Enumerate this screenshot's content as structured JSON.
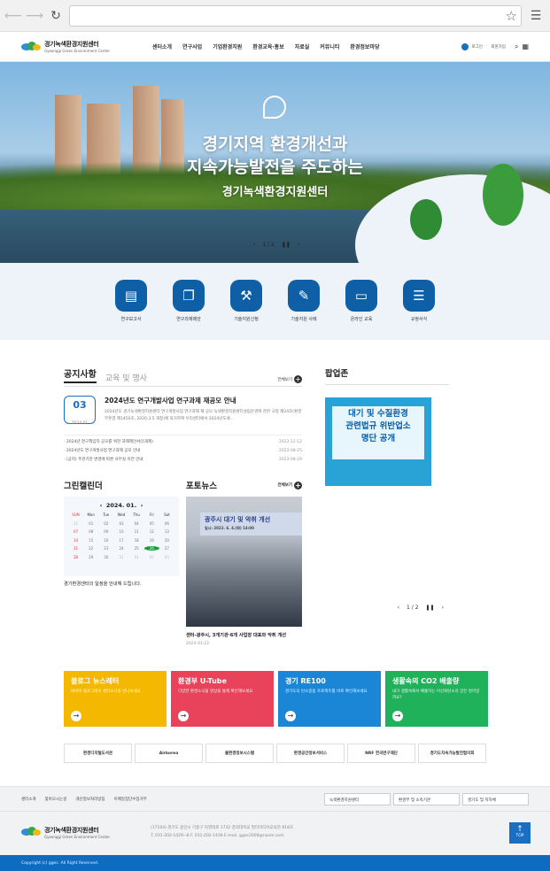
{
  "header": {
    "logo_title": "경기녹색환경지원센터",
    "logo_sub": "Gyeonggi Green Environment Center",
    "nav": [
      "센터소개",
      "연구사업",
      "기업환경지원",
      "환경교육·홍보",
      "자료실",
      "커뮤니티",
      "환경정보마당"
    ],
    "login": "로그인",
    "join": "회원가입"
  },
  "hero": {
    "line1": "경기지역 환경개선과",
    "line2": "지속가능발전을 주도하는",
    "line3": "경기녹색환경지원센터",
    "page": "1 / 2"
  },
  "quick": [
    {
      "label": "연구보고서",
      "icon": "▤"
    },
    {
      "label": "연구과제제안",
      "icon": "❐"
    },
    {
      "label": "기술지원신청",
      "icon": "⚒"
    },
    {
      "label": "기술지원 사례",
      "icon": "✎"
    },
    {
      "label": "온라인 교육",
      "icon": "▭"
    },
    {
      "label": "규정서식",
      "icon": "☰"
    }
  ],
  "notice": {
    "tab_active": "공지사항",
    "tab_inactive": "교육 및 행사",
    "more": "전체보기",
    "top_day": "03",
    "top_month": "2024.01",
    "top_title": "2024년도 연구개발사업 연구과제 재공모 안내",
    "top_desc": "2024년도 경기녹색환경지원센터 연구개발사업 연구과제 재 공모 녹색환경지원센터설립운영에 관한 규정 제24조(환경부훈령 제1450호, 2020.3.5 개정)에 의거하여 우리센터에서 2024년도에...",
    "items": [
      {
        "title": "· 2024년 연구책임자 공모를 위한 과제제안서(5개제)",
        "date": "2023-12-12"
      },
      {
        "title": "· 2024년도 연구개발사업 연구과제 공모 안내",
        "date": "2023-08-25"
      },
      {
        "title": "· (공지) 주관기관 변경에 따른 사무실 이전 안내",
        "date": "2023-08-29"
      }
    ]
  },
  "calendar": {
    "title": "그린캘린더",
    "month": "2024. 01.",
    "weekdays": [
      "SUN",
      "Mon",
      "Tue",
      "Wed",
      "Thu",
      "Fri",
      "Sat"
    ],
    "days": [
      "31",
      "01",
      "02",
      "03",
      "04",
      "05",
      "06",
      "07",
      "08",
      "09",
      "10",
      "11",
      "12",
      "13",
      "14",
      "15",
      "16",
      "17",
      "18",
      "19",
      "20",
      "21",
      "22",
      "23",
      "24",
      "25",
      "26",
      "27",
      "28",
      "29",
      "30",
      "31",
      "01",
      "02",
      "03"
    ],
    "note": "경기환경센터의 일정을 안내해 드립니다."
  },
  "photo": {
    "title": "포토뉴스",
    "more": "전체보기",
    "banner": "광주시 대기 및 악취 개선",
    "banner_sub": "일시: 2022. 6. 4.(화) 14:00",
    "caption": "센터-광주시, 3개기관·6개 사업장 대표와 악취 개선",
    "date": "2024-01-22"
  },
  "popup": {
    "title": "팝업존",
    "line1": "대기 및 수질환경",
    "line2": "관련법규 위반업소",
    "line3": "명단 공개",
    "page": "1 / 2"
  },
  "banners": [
    {
      "title": "블로그 뉴스레터",
      "desc": "네이버 블로그에서 센터소식을 만나보세요",
      "color": "#f5b800"
    },
    {
      "title": "환경부 U-Tube",
      "desc": "다양한 환경소식을 영상을 통해 확인해보세요",
      "color": "#e8435a"
    },
    {
      "title": "경기 RE100",
      "desc": "경기도의 탄소중립 프로젝트를 바로 확인해보세요",
      "color": "#1b86d6"
    },
    {
      "title": "생활속의 CO2 배출량",
      "desc": "내가 생활속에서 배출하는 이산화탄소의 양은 얼마일까요?",
      "color": "#1fb25a"
    }
  ],
  "partners": [
    "환경디지털도서관",
    "Airkorea",
    "물환경정보시스템",
    "환경공간정보서비스",
    "NRF 한국연구재단",
    "경기도지속가능발전협의회"
  ],
  "footer": {
    "links": [
      "센터소개",
      "찾아오시는길",
      "개인정보처리방침",
      "이메일집단수집거부"
    ],
    "selects": [
      "녹색환경지원센터",
      "환경부 및 소속기관",
      "경기도 및 지자체"
    ],
    "address": "(17104) 경기도 용인시 기흥구 덕영대로 1732 경희대학교 멀티미디어교육관 818호",
    "contact": "T. 031-202-1429~8    F. 031-202-1439    E-mail. ggec2000@naver.com",
    "top": "TOP",
    "copyright": "Copyright (c) ggec. All Right Reserved."
  }
}
